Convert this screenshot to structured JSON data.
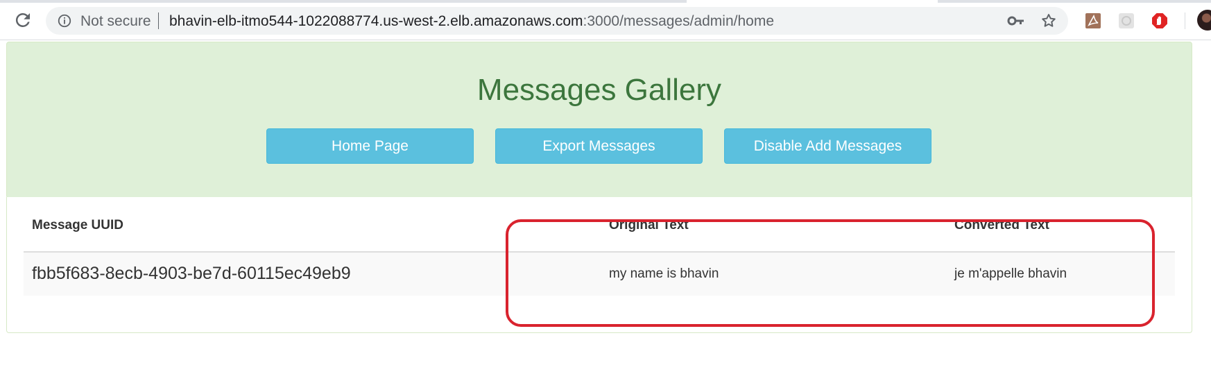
{
  "browser": {
    "security_label": "Not secure",
    "url_host": "bhavin-elb-itmo544-1022088774.us-west-2.elb.amazonaws.com",
    "url_path": ":3000/messages/admin/home",
    "icons": [
      "reload-icon",
      "info-icon",
      "key-icon",
      "star-icon",
      "pdf-extension-icon",
      "grey-extension-icon",
      "stop-extension-icon",
      "profile-avatar"
    ]
  },
  "page": {
    "title": "Messages Gallery",
    "buttons": {
      "home": "Home Page",
      "export": "Export Messages",
      "disable": "Disable Add Messages"
    },
    "colors": {
      "jumbotron_bg": "#dff0d8",
      "title": "#3c763d",
      "button": "#5bc0de",
      "highlight": "#d9232e"
    }
  },
  "table": {
    "headers": [
      "Message UUID",
      "Original Text",
      "Converted Text"
    ],
    "rows": [
      [
        "fbb5f683-8ecb-4903-be7d-60115ec49eb9",
        "my name is bhavin",
        "je m'appelle bhavin"
      ]
    ]
  }
}
